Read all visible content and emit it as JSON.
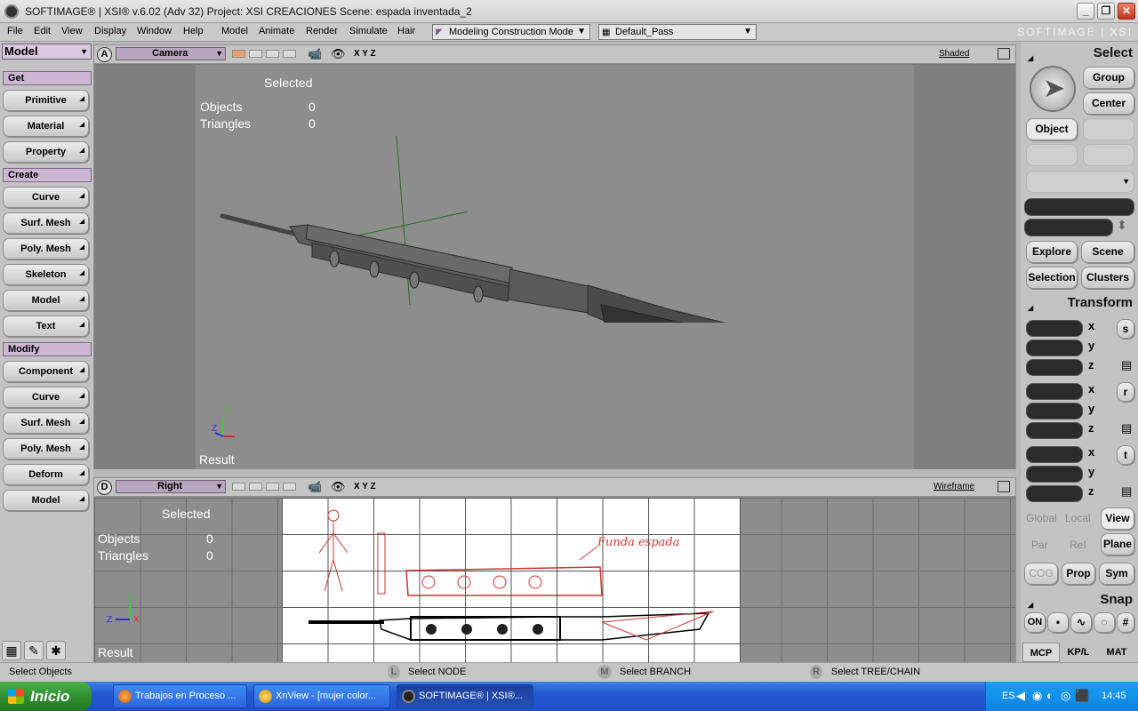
{
  "titlebar": {
    "title": "SOFTIMAGE® | XSI® v.6.02 (Adv 32) Project: XSI CREACIONES    Scene: espada inventada_2"
  },
  "menus": [
    "File",
    "Edit",
    "View",
    "Display",
    "Window",
    "Help",
    "Model",
    "Animate",
    "Render",
    "Simulate",
    "Hair"
  ],
  "construction_mode": "Modeling Construction Mode",
  "pass": "Default_Pass",
  "brand": "SOFTIMAGE | XSI",
  "left": {
    "mode": "Model",
    "get": {
      "header": "Get",
      "buttons": [
        "Primitive",
        "Material",
        "Property"
      ]
    },
    "create": {
      "header": "Create",
      "buttons": [
        "Curve",
        "Surf. Mesh",
        "Poly. Mesh",
        "Skeleton",
        "Model",
        "Text"
      ]
    },
    "modify": {
      "header": "Modify",
      "buttons": [
        "Component",
        "Curve",
        "Surf. Mesh",
        "Poly. Mesh",
        "Deform",
        "Model"
      ]
    }
  },
  "viewportA": {
    "letter": "A",
    "camera": "Camera",
    "xyz": "X Y Z",
    "display": "Shaded",
    "hud": {
      "selected": "Selected",
      "objects_label": "Objects",
      "objects_value": "0",
      "triangles_label": "Triangles",
      "triangles_value": "0",
      "result": "Result"
    }
  },
  "viewportD": {
    "letter": "D",
    "camera": "Right",
    "xyz": "X Y Z",
    "display": "Wireframe",
    "hud": {
      "selected": "Selected",
      "objects_label": "Objects",
      "objects_value": "0",
      "triangles_label": "Triangles",
      "triangles_value": "0",
      "result": "Result"
    },
    "sketch_note": "Funda espada"
  },
  "right": {
    "select": {
      "header": "Select",
      "group": "Group",
      "center": "Center",
      "object": "Object"
    },
    "explore": "Explore",
    "scene": "Scene",
    "selection": "Selection",
    "clusters": "Clusters",
    "transform": {
      "header": "Transform",
      "axes": [
        "x",
        "y",
        "z"
      ],
      "scale": "s",
      "rotate": "r",
      "translate": "t"
    },
    "space": [
      "Global",
      "Local",
      "View"
    ],
    "ref": [
      "Par",
      "Ref",
      "Plane"
    ],
    "cog": "COG",
    "prop": "Prop",
    "sym": "Sym",
    "snap": {
      "header": "Snap",
      "on": "ON"
    },
    "tabs": [
      "MCP",
      "KP/L",
      "MAT"
    ]
  },
  "status": {
    "main": "Select Objects",
    "l_key": "L",
    "l": "Select NODE",
    "m_key": "M",
    "m": "Select BRANCH",
    "r_key": "R",
    "r": "Select TREE/CHAIN"
  },
  "taskbar": {
    "start": "Inicio",
    "tasks": [
      "Trabajos en Proceso ...",
      "XnView - [mujer color...",
      "SOFTIMAGE® | XSI®..."
    ],
    "lang": "ES",
    "time": "14:45"
  }
}
